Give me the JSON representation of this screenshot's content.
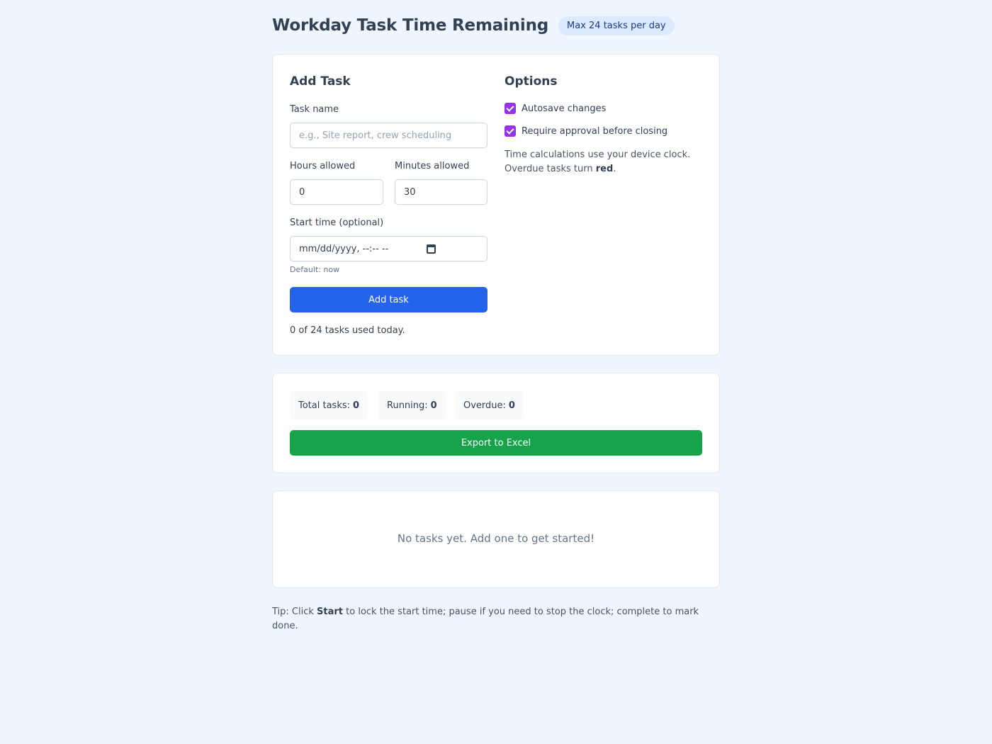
{
  "header": {
    "title": "Workday Task Time Remaining",
    "badge": "Max 24 tasks per day"
  },
  "add_task": {
    "title": "Add Task",
    "task_name_label": "Task name",
    "task_name_placeholder": "e.g., Site report, crew scheduling",
    "task_name_value": "",
    "hours_label": "Hours allowed",
    "hours_value": "0",
    "minutes_label": "Minutes allowed",
    "minutes_value": "30",
    "start_label": "Start time (optional)",
    "start_placeholder": "mm/dd/yyyy, --:-- --",
    "start_hint": "Default: now",
    "add_button": "Add task",
    "usage_text": "0 of 24 tasks used today."
  },
  "options": {
    "title": "Options",
    "autosave_label": "Autosave changes",
    "autosave_checked": true,
    "approval_label": "Require approval before closing",
    "approval_checked": true,
    "note_line1": "Time calculations use your device clock.",
    "note_line2_prefix": "Overdue tasks turn ",
    "note_line2_bold": "red",
    "note_line2_suffix": "."
  },
  "stats": {
    "total_label": "Total tasks:",
    "total_value": "0",
    "running_label": "Running:",
    "running_value": "0",
    "overdue_label": "Overdue:",
    "overdue_value": "0",
    "export_button": "Export to Excel"
  },
  "task_list": {
    "empty_message": "No tasks yet. Add one to get started!"
  },
  "tip": {
    "prefix": "Tip: Click ",
    "bold": "Start",
    "suffix": " to lock the start time; pause if you need to stop the clock; complete to mark done."
  },
  "colors": {
    "page_background": "#eff6ff",
    "primary_button": "#2563eb",
    "export_button": "#16a34a",
    "checkbox_accent": "#9333ea",
    "badge_background": "#dbeafe"
  }
}
